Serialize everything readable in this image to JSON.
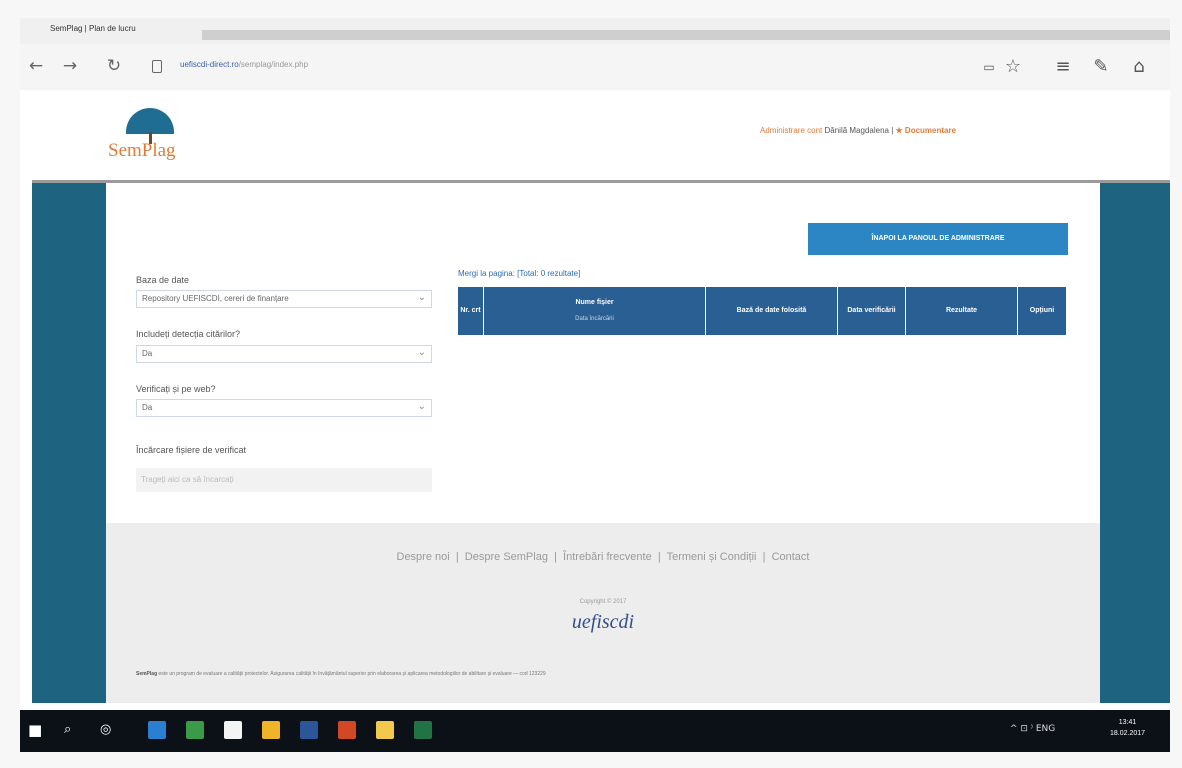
{
  "browser": {
    "tab_title": "SemPlag | Plan de lucru",
    "url_host": "uefiscdi-direct.ro",
    "url_path": "/semplag/index.php"
  },
  "header": {
    "logo_text": "SemPlag",
    "admin_link": "Administrare cont",
    "user_name": "Dănilă Magdalena",
    "separator": "|",
    "doc_link": "★ Documentare"
  },
  "actions": {
    "back_button": "ÎNAPOI LA PANOUL DE ADMINISTRARE"
  },
  "form": {
    "database_label": "Baza de date",
    "database_value": "Repository UEFISCDI, cereri de finanțare",
    "quotes_label": "Includeți detecția citărilor?",
    "quotes_value": "Da",
    "web_label": "Verificați și pe web?",
    "web_value": "Da",
    "upload_label": "Încărcare fișiere de verificat",
    "upload_placeholder": "Trageți aici ca să încarcați"
  },
  "table": {
    "show_page_text": "Mergi la pagina: [Total: 0 rezultate]",
    "columns": [
      {
        "label": "Nr. crt",
        "sub": ""
      },
      {
        "label": "Nume fișier",
        "sub": "Data încărcării"
      },
      {
        "label": "Bază de date folosită",
        "sub": ""
      },
      {
        "label": "Data verificării",
        "sub": ""
      },
      {
        "label": "Rezultate",
        "sub": ""
      },
      {
        "label": "Opțiuni",
        "sub": ""
      }
    ]
  },
  "footer": {
    "links": [
      "Despre noi",
      "Despre SemPlag",
      "Întrebări frecvente",
      "Termeni și Condiții",
      "Contact"
    ],
    "copyright": "Copyright © 2017",
    "logo": "uefiscdi",
    "note_prefix": "SemPlag",
    "note_text": "este un program de evaluare a calității proiectelor. Asigurarea calității în învățământul superior prin elaborarea și aplicarea metodologiilor de abilitare și evaluare — cod 123229"
  },
  "taskbar": {
    "tray": "^ ⊡ ⁾ ENG",
    "time": "13:41",
    "date": "18.02.2017"
  },
  "colors": {
    "accent_blue": "#2b86c3",
    "table_header": "#2a5f94",
    "side_bar": "#1e6480",
    "orange": "#e07b39"
  }
}
